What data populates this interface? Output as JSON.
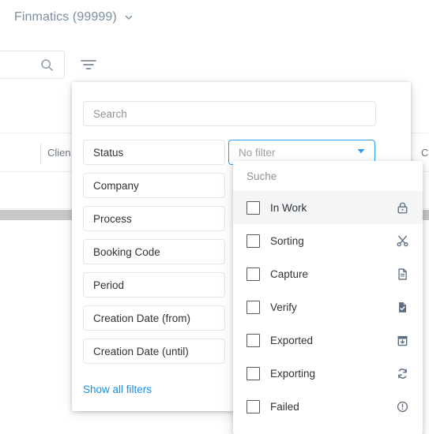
{
  "topbar": {
    "client_name": "Finmatics (99999)",
    "chevron_icon": "chevron-down-icon"
  },
  "toolbar": {
    "search_icon": "search-icon",
    "filter_icon": "filter-icon"
  },
  "table": {
    "columns": [
      {
        "label": "Clien"
      },
      {
        "label": "C"
      }
    ]
  },
  "filter_panel": {
    "search": {
      "placeholder": "Search",
      "value": ""
    },
    "fields": [
      {
        "label": "Status"
      },
      {
        "label": "Company"
      },
      {
        "label": "Process"
      },
      {
        "label": "Booking Code"
      },
      {
        "label": "Period"
      },
      {
        "label": "Creation Date (from)"
      },
      {
        "label": "Creation Date (until)"
      }
    ],
    "show_all_filters_label": "Show all filters",
    "status_select": {
      "value": "No filter",
      "arrow_icon": "chevron-down-icon",
      "border_color": "#2d9bf0"
    }
  },
  "status_dropdown": {
    "search_placeholder": "Suche",
    "options": [
      {
        "label": "In Work",
        "icon": "lock-icon",
        "checked": false,
        "hovered": true
      },
      {
        "label": "Sorting",
        "icon": "scissors-icon",
        "checked": false,
        "hovered": false
      },
      {
        "label": "Capture",
        "icon": "document-icon",
        "checked": false,
        "hovered": false
      },
      {
        "label": "Verify",
        "icon": "document-check-icon",
        "checked": false,
        "hovered": false
      },
      {
        "label": "Exported",
        "icon": "box-download-icon",
        "checked": false,
        "hovered": false
      },
      {
        "label": "Exporting",
        "icon": "sync-icon",
        "checked": false,
        "hovered": false
      },
      {
        "label": "Failed",
        "icon": "alert-circle-icon",
        "checked": false,
        "hovered": false
      }
    ]
  },
  "colors": {
    "accent": "#2d9bf0",
    "link": "#1b8ee6",
    "client_text": "#7b8fa1",
    "icon_grey": "#5d6e82"
  }
}
